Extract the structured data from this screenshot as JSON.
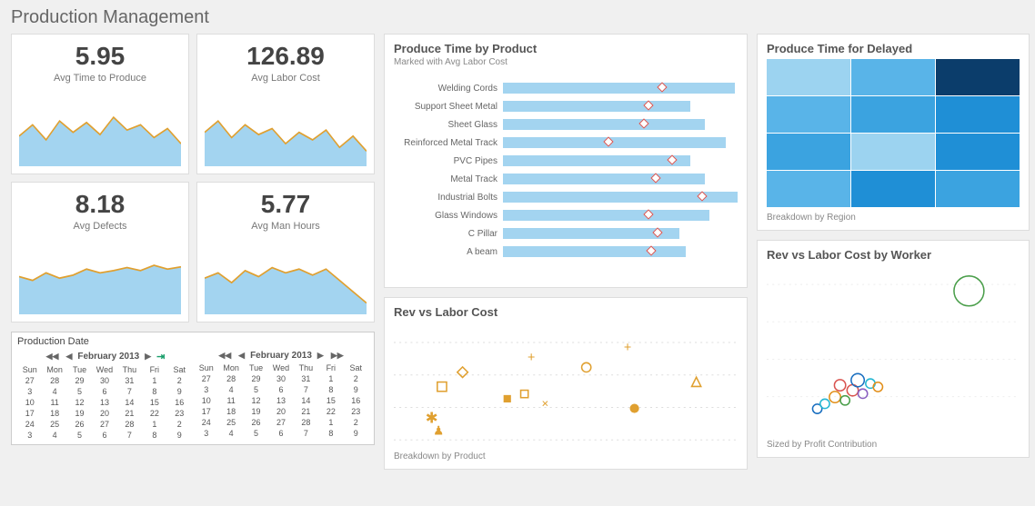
{
  "page_title": "Production Management",
  "kpi": [
    {
      "value": "5.95",
      "label": "Avg Time to Produce",
      "spark": [
        40,
        55,
        35,
        60,
        45,
        58,
        42,
        65,
        48,
        55,
        38,
        50,
        30
      ]
    },
    {
      "value": "126.89",
      "label": "Avg Labor Cost",
      "spark": [
        45,
        60,
        38,
        55,
        42,
        50,
        30,
        45,
        35,
        48,
        25,
        40,
        20
      ]
    },
    {
      "value": "8.18",
      "label": "Avg Defects",
      "spark": [
        50,
        45,
        55,
        48,
        52,
        60,
        55,
        58,
        62,
        58,
        65,
        60,
        63
      ]
    },
    {
      "value": "5.77",
      "label": "Avg Man Hours",
      "spark": [
        48,
        55,
        42,
        58,
        50,
        62,
        55,
        60,
        52,
        60,
        45,
        30,
        15
      ]
    }
  ],
  "produce_time": {
    "title": "Produce Time by Product",
    "subtitle": "Marked with Avg Labor Cost"
  },
  "rev_labor": {
    "title": "Rev vs Labor Cost",
    "footnote": "Breakdown by Product"
  },
  "heat": {
    "title": "Produce Time for Delayed",
    "footnote": "Breakdown by Region"
  },
  "worker": {
    "title": "Rev vs Labor Cost by Worker",
    "footnote": "Sized by Profit Contribution"
  },
  "calendar": {
    "title": "Production Date",
    "month": "February 2013"
  },
  "chart_data": {
    "kpi_sparklines": {
      "type": "line",
      "note": "four small area sparklines under each KPI; arbitrary units",
      "series": [
        {
          "name": "Avg Time to Produce",
          "values": [
            40,
            55,
            35,
            60,
            45,
            58,
            42,
            65,
            48,
            55,
            38,
            50,
            30
          ]
        },
        {
          "name": "Avg Labor Cost",
          "values": [
            45,
            60,
            38,
            55,
            42,
            50,
            30,
            45,
            35,
            48,
            25,
            40,
            20
          ]
        },
        {
          "name": "Avg Defects",
          "values": [
            50,
            45,
            55,
            48,
            52,
            60,
            55,
            58,
            62,
            58,
            65,
            60,
            63
          ]
        },
        {
          "name": "Avg Man Hours",
          "values": [
            48,
            55,
            42,
            58,
            50,
            62,
            55,
            60,
            52,
            60,
            45,
            30,
            15
          ]
        }
      ]
    },
    "produce_time_by_product": {
      "type": "bar",
      "title": "Produce Time by Product",
      "subtitle": "Marked with Avg Labor Cost",
      "xlabel": "",
      "ylabel": "",
      "xlim": [
        0,
        100
      ],
      "categories": [
        "Welding Cords",
        "Support Sheet Metal",
        "Sheet Glass",
        "Reinforced Metal Track",
        "PVC Pipes",
        "Metal Track",
        "Industrial Bolts",
        "Glass Windows",
        "C Pillar",
        "A beam"
      ],
      "series": [
        {
          "name": "Produce Time (bar %)",
          "values": [
            99,
            80,
            86,
            95,
            80,
            86,
            100,
            88,
            75,
            78
          ]
        },
        {
          "name": "Avg Labor Cost marker (bar %)",
          "values": [
            68,
            62,
            60,
            45,
            72,
            65,
            85,
            62,
            66,
            63
          ]
        }
      ]
    },
    "rev_vs_labor_cost": {
      "type": "scatter",
      "title": "Rev vs Labor Cost",
      "note": "Breakdown by Product; axes unlabeled in source; values are relative 0-100",
      "points": [
        {
          "name": "square-open",
          "x": 14,
          "y": 52
        },
        {
          "name": "diamond-open",
          "x": 20,
          "y": 40
        },
        {
          "name": "star",
          "x": 11,
          "y": 78
        },
        {
          "name": "trophy",
          "x": 13,
          "y": 88
        },
        {
          "name": "square-solid",
          "x": 33,
          "y": 62
        },
        {
          "name": "square-open-2",
          "x": 38,
          "y": 58
        },
        {
          "name": "plus-1",
          "x": 40,
          "y": 28
        },
        {
          "name": "cross",
          "x": 44,
          "y": 66
        },
        {
          "name": "circle-open",
          "x": 56,
          "y": 36
        },
        {
          "name": "plus-2",
          "x": 68,
          "y": 20
        },
        {
          "name": "circle-solid",
          "x": 70,
          "y": 70
        },
        {
          "name": "triangle-open",
          "x": 88,
          "y": 48
        }
      ]
    },
    "produce_time_for_delayed": {
      "type": "heatmap",
      "title": "Produce Time for Delayed",
      "note": "Breakdown by Region; 4 rows × 3 cols, values 0-100 intensity estimate",
      "rows": 4,
      "cols": 3,
      "values": [
        [
          30,
          45,
          95
        ],
        [
          45,
          55,
          60
        ],
        [
          55,
          25,
          65
        ],
        [
          40,
          65,
          55
        ]
      ]
    },
    "rev_vs_labor_cost_by_worker": {
      "type": "scatter",
      "title": "Rev vs Labor Cost by Worker",
      "note": "Sized by Profit Contribution; axes unlabeled; values relative 0-100",
      "points": [
        {
          "x": 80,
          "y": 15,
          "r": 16,
          "color": "#4a9e4a"
        },
        {
          "x": 20,
          "y": 85,
          "r": 5,
          "color": "#1a6fc0"
        },
        {
          "x": 23,
          "y": 82,
          "r": 5,
          "color": "#25b7d3"
        },
        {
          "x": 27,
          "y": 78,
          "r": 6,
          "color": "#e28f1a"
        },
        {
          "x": 31,
          "y": 80,
          "r": 5,
          "color": "#4a9e4a"
        },
        {
          "x": 34,
          "y": 74,
          "r": 6,
          "color": "#d9534f"
        },
        {
          "x": 38,
          "y": 76,
          "r": 5,
          "color": "#8a5fc0"
        },
        {
          "x": 41,
          "y": 70,
          "r": 5,
          "color": "#25b7d3"
        },
        {
          "x": 36,
          "y": 68,
          "r": 7,
          "color": "#1a6fc0"
        },
        {
          "x": 44,
          "y": 72,
          "r": 5,
          "color": "#e28f1a"
        },
        {
          "x": 29,
          "y": 71,
          "r": 6,
          "color": "#d9534f"
        }
      ]
    },
    "calendar": {
      "type": "table",
      "title": "Production Date",
      "month": "February 2013",
      "days": [
        "Sun",
        "Mon",
        "Tue",
        "Wed",
        "Thu",
        "Fri",
        "Sat"
      ],
      "weeks": [
        [
          27,
          28,
          29,
          30,
          31,
          1,
          2
        ],
        [
          3,
          4,
          5,
          6,
          7,
          8,
          9
        ],
        [
          10,
          11,
          12,
          13,
          14,
          15,
          16
        ],
        [
          17,
          18,
          19,
          20,
          21,
          22,
          23
        ],
        [
          24,
          25,
          26,
          27,
          28,
          1,
          2
        ],
        [
          3,
          4,
          5,
          6,
          7,
          8,
          9
        ]
      ]
    }
  }
}
